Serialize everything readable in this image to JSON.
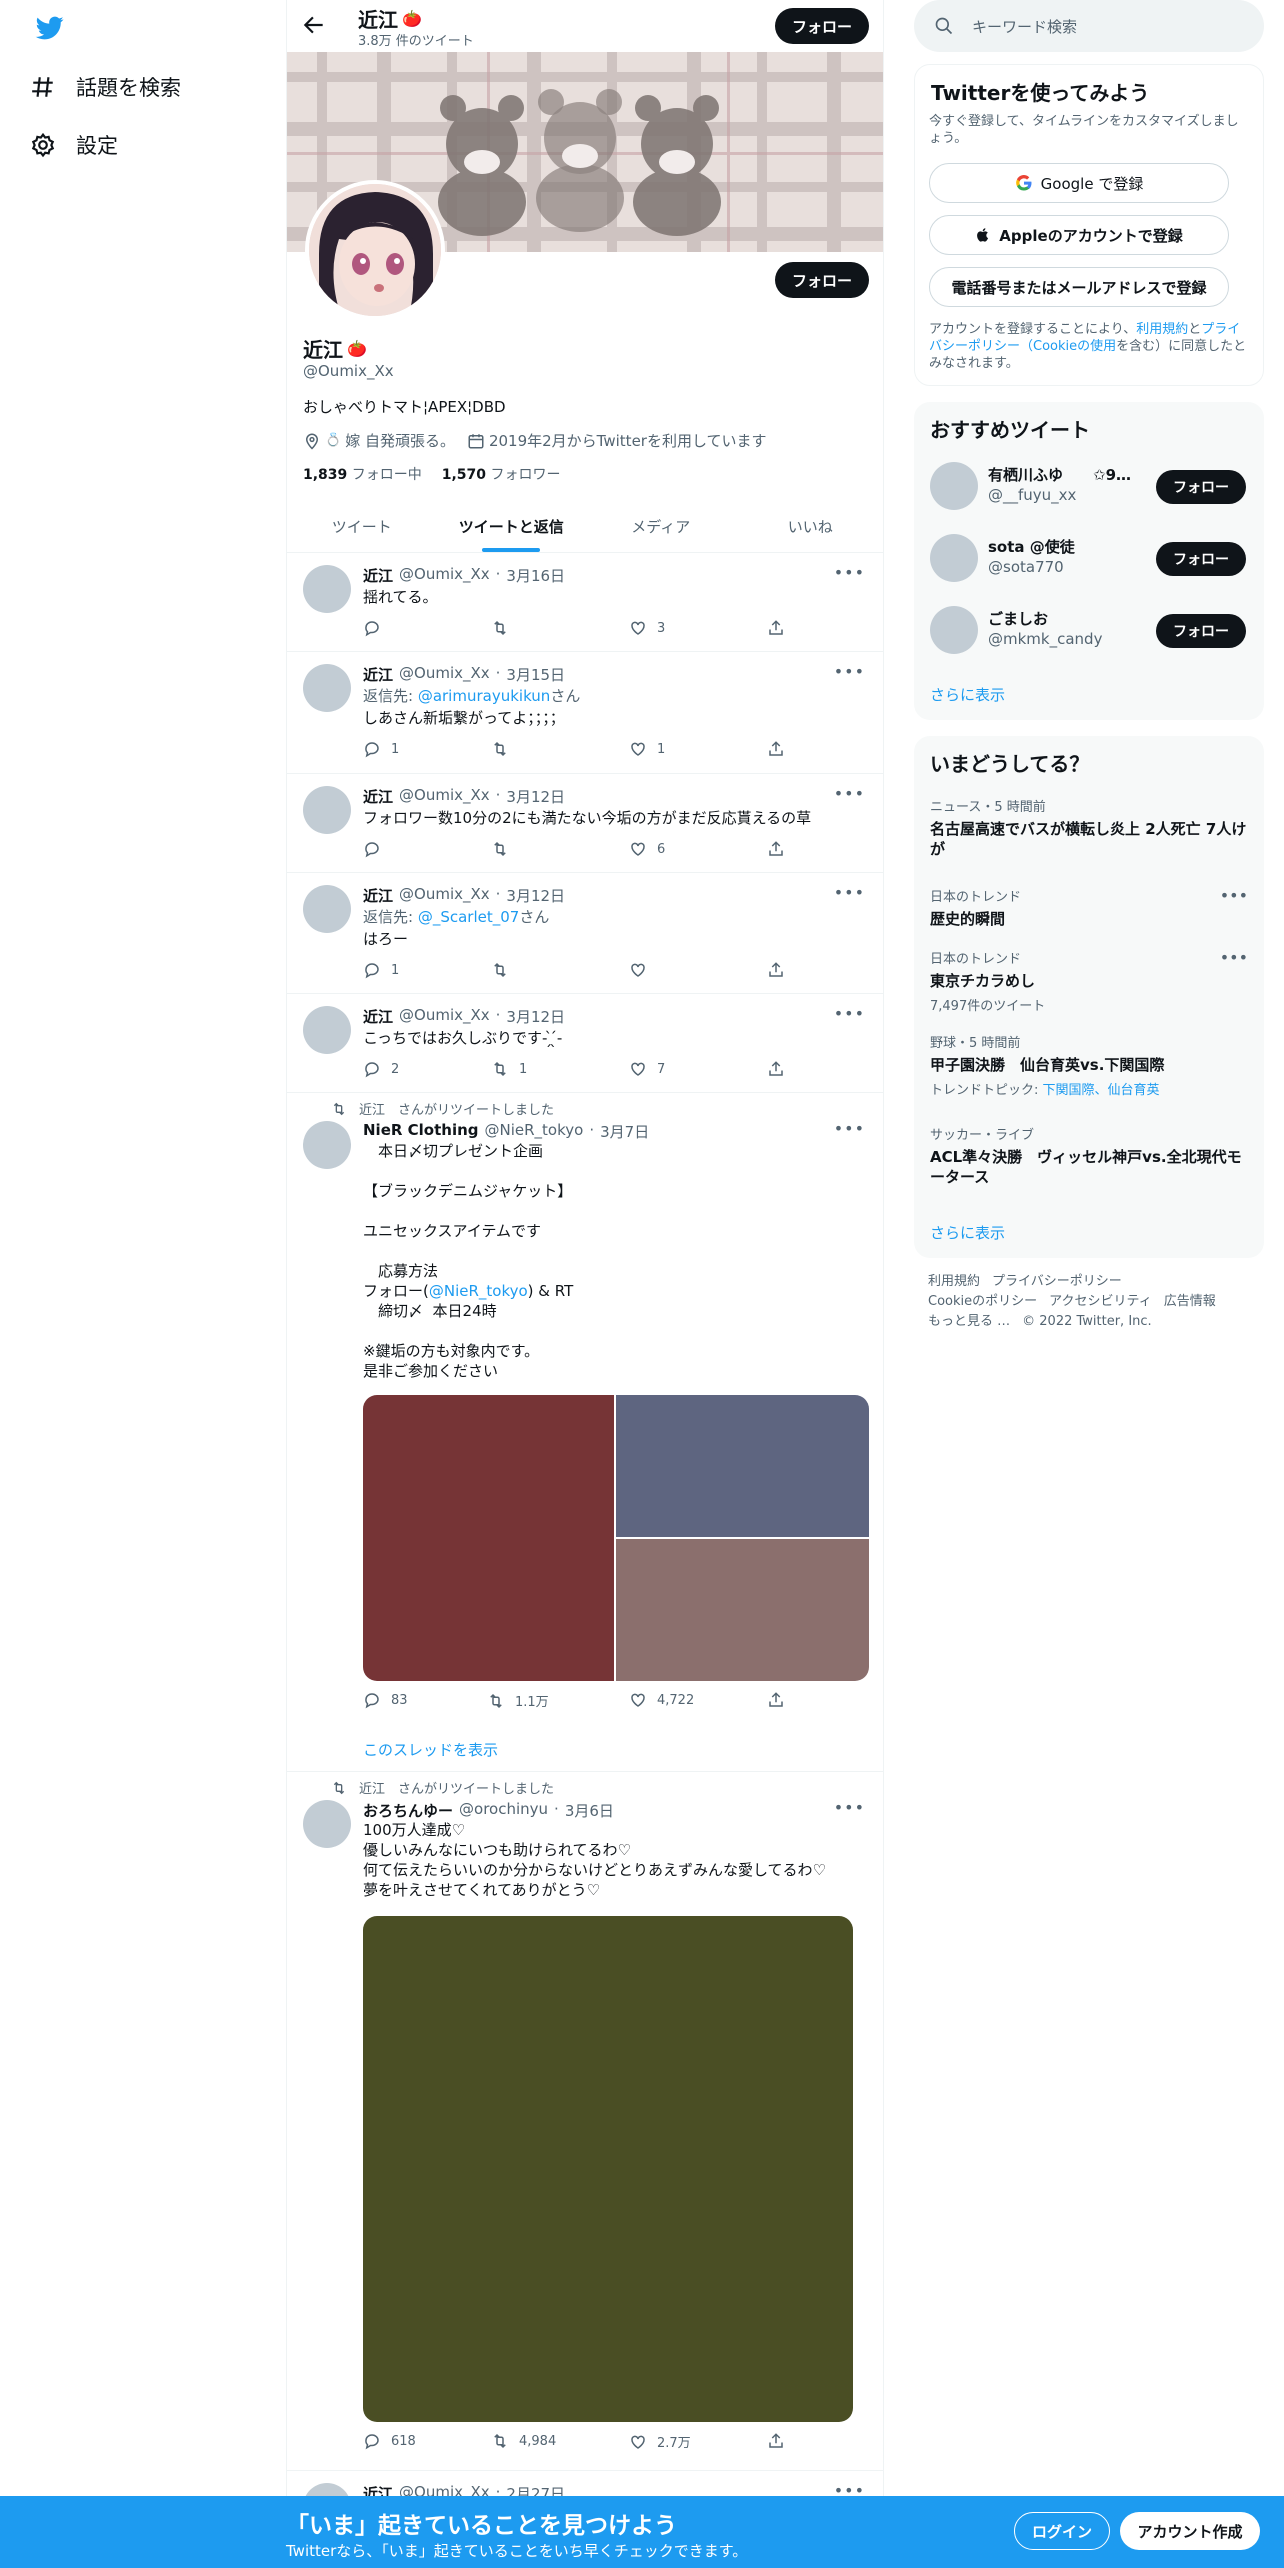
{
  "leftnav": {
    "items": [
      {
        "label": "話題を検索",
        "icon": "hashtag-icon"
      },
      {
        "label": "設定",
        "icon": "gear-icon"
      }
    ]
  },
  "header": {
    "name": "近江",
    "tweet_count": "3.8万 件のツイート",
    "follow_label": "フォロー"
  },
  "profile": {
    "name": "近江",
    "handle": "@Oumix_Xx",
    "bio": "おしゃべりトマト¦APEX¦DBD",
    "location": "嫁 自発頑張る。",
    "joined": "2019年2月からTwitterを利用しています",
    "following_count": "1,839",
    "following_label": "フォロー中",
    "followers_count": "1,570",
    "followers_label": "フォロワー",
    "follow_label": "フォロー"
  },
  "tabs": [
    "ツイート",
    "ツイートと返信",
    "メディア",
    "いいね"
  ],
  "active_tab": "ツイートと返信",
  "tweets": [
    {
      "name": "近江",
      "handle": "@Oumix_Xx",
      "date": "3月16日",
      "reply_to": "",
      "text": "揺れてる。",
      "replies": "",
      "retweets": "",
      "likes": "3"
    },
    {
      "name": "近江",
      "handle": "@Oumix_Xx",
      "date": "3月15日",
      "reply_prefix": "返信先: ",
      "reply_to": "@arimurayukikun",
      "reply_suffix": "さん",
      "text": "しあさん新垢繋がってよ；；；；",
      "replies": "1",
      "retweets": "",
      "likes": "1"
    },
    {
      "name": "近江",
      "handle": "@Oumix_Xx",
      "date": "3月12日",
      "reply_to": "",
      "text": "フォロワー数10分の2にも満たない今垢の方がまだ反応貰えるの草",
      "replies": "",
      "retweets": "",
      "likes": "6"
    },
    {
      "name": "近江",
      "handle": "@Oumix_Xx",
      "date": "3月12日",
      "reply_prefix": "返信先: ",
      "reply_to": "@_Scarlet_07",
      "reply_suffix": "さん",
      "text": "はろー",
      "replies": "1",
      "retweets": "",
      "likes": ""
    },
    {
      "name": "近江",
      "handle": "@Oumix_Xx",
      "date": "3月12日",
      "reply_to": "",
      "text": "こっちではお久しぶりです- ̗̀ ̖́-",
      "replies": "2",
      "retweets": "1",
      "likes": "7"
    },
    {
      "retweeted_by": "近江　さんがリツイートしました",
      "name": "NieR Clothing",
      "handle": "@NieR_tokyo",
      "date": "3月7日",
      "text_1": "　本日〆切プレゼント企画\n\n【ブラックデニムジャケット】\n\nユニセックスアイテムです\n\n　応募方法\nフォロー(",
      "text_link": "@NieR_tokyo",
      "text_2": ") & RT\n　締切〆  本日24時\n\n※鍵垢の方も対象内です。\n是非ご参加ください",
      "replies": "83",
      "retweets": "1.1万",
      "likes": "4,722",
      "thread_link": "このスレッドを表示",
      "media_colors": [
        "#763436",
        "#5e6580",
        "#8b6f6d"
      ]
    },
    {
      "retweeted_by": "近江　さんがリツイートしました",
      "name": "おろちんゆー",
      "handle": "@orochinyu",
      "date": "3月6日",
      "text": "100万人達成♡\n優しいみんなにいつも助けられてるわ♡\n何て伝えたらいいのか分からないけどとりあえずみんな愛してるわ♡\n夢を叶えさせてくれてありがとう♡",
      "replies": "618",
      "retweets": "4,984",
      "likes": "2.7万",
      "media_colors": [
        "#4a4e24"
      ]
    },
    {
      "name": "近江",
      "handle": "@Oumix_Xx",
      "date": "2月27日"
    }
  ],
  "right": {
    "search_placeholder": "キーワード検索",
    "signup": {
      "title": "Twitterを使ってみよう",
      "subtitle": "今すぐ登録して、タイムラインをカスタマイズしましょう。",
      "google": "Google で登録",
      "apple": "Appleのアカウントで登録",
      "phone": "電話番号またはメールアドレスで登録",
      "terms_1": "アカウントを登録することにより、",
      "terms_link1": "利用規約",
      "terms_2": "と",
      "terms_link2": "プライバシーポリシー（Cookieの使用",
      "terms_3": "を含む）に同意したとみなされます。"
    },
    "recommended": {
      "title": "おすすめツイート",
      "users": [
        {
          "name": "有栖川ふゆ　　✩9…",
          "handle": "@__fuyu_xx"
        },
        {
          "name": "sota @使徒",
          "handle": "@sota770"
        },
        {
          "name": "ごましお",
          "handle": "@mkmk_candy"
        }
      ],
      "follow_label": "フォロー",
      "more": "さらに表示"
    },
    "trends": {
      "title": "いまどうしてる？",
      "items": [
        {
          "category": "ニュース・5 時間前",
          "title": "名古屋高速でバスが横転し炎上 2人死亡 7人けが",
          "sub": "",
          "sub_links": ""
        },
        {
          "category": "日本のトレンド",
          "title": "歴史的瞬間",
          "sub": "",
          "sub_links": ""
        },
        {
          "category": "日本のトレンド",
          "title": "東京チカラめし",
          "sub": "7,497件のツイート",
          "sub_links": ""
        },
        {
          "category": "野球・5 時間前",
          "title": "甲子園決勝　仙台育英vs.下関国際",
          "sub": "トレンドトピック: ",
          "sub_links": "下関国際、仙台育英"
        },
        {
          "category": "サッカー・ライブ",
          "title": "ACL準々決勝　ヴィッセル神戸vs.全北現代モータース",
          "sub": "",
          "sub_links": ""
        }
      ],
      "more": "さらに表示"
    },
    "footer": [
      "利用規約",
      "プライバシーポリシー",
      "Cookieのポリシー",
      "アクセシビリティ",
      "広告情報",
      "もっと見る …",
      "© 2022 Twitter, Inc."
    ]
  },
  "bottom_bar": {
    "title": "「いま」起きていることを見つけよう",
    "subtitle": "Twitterなら、「いま」起きていることをいち早くチェックできます。",
    "login": "ログイン",
    "signup": "アカウント作成"
  },
  "colors": {
    "accent": "#1d9bf0",
    "text": "#0f1419",
    "muted": "#536471",
    "panel_bg": "#f7f9f9"
  }
}
